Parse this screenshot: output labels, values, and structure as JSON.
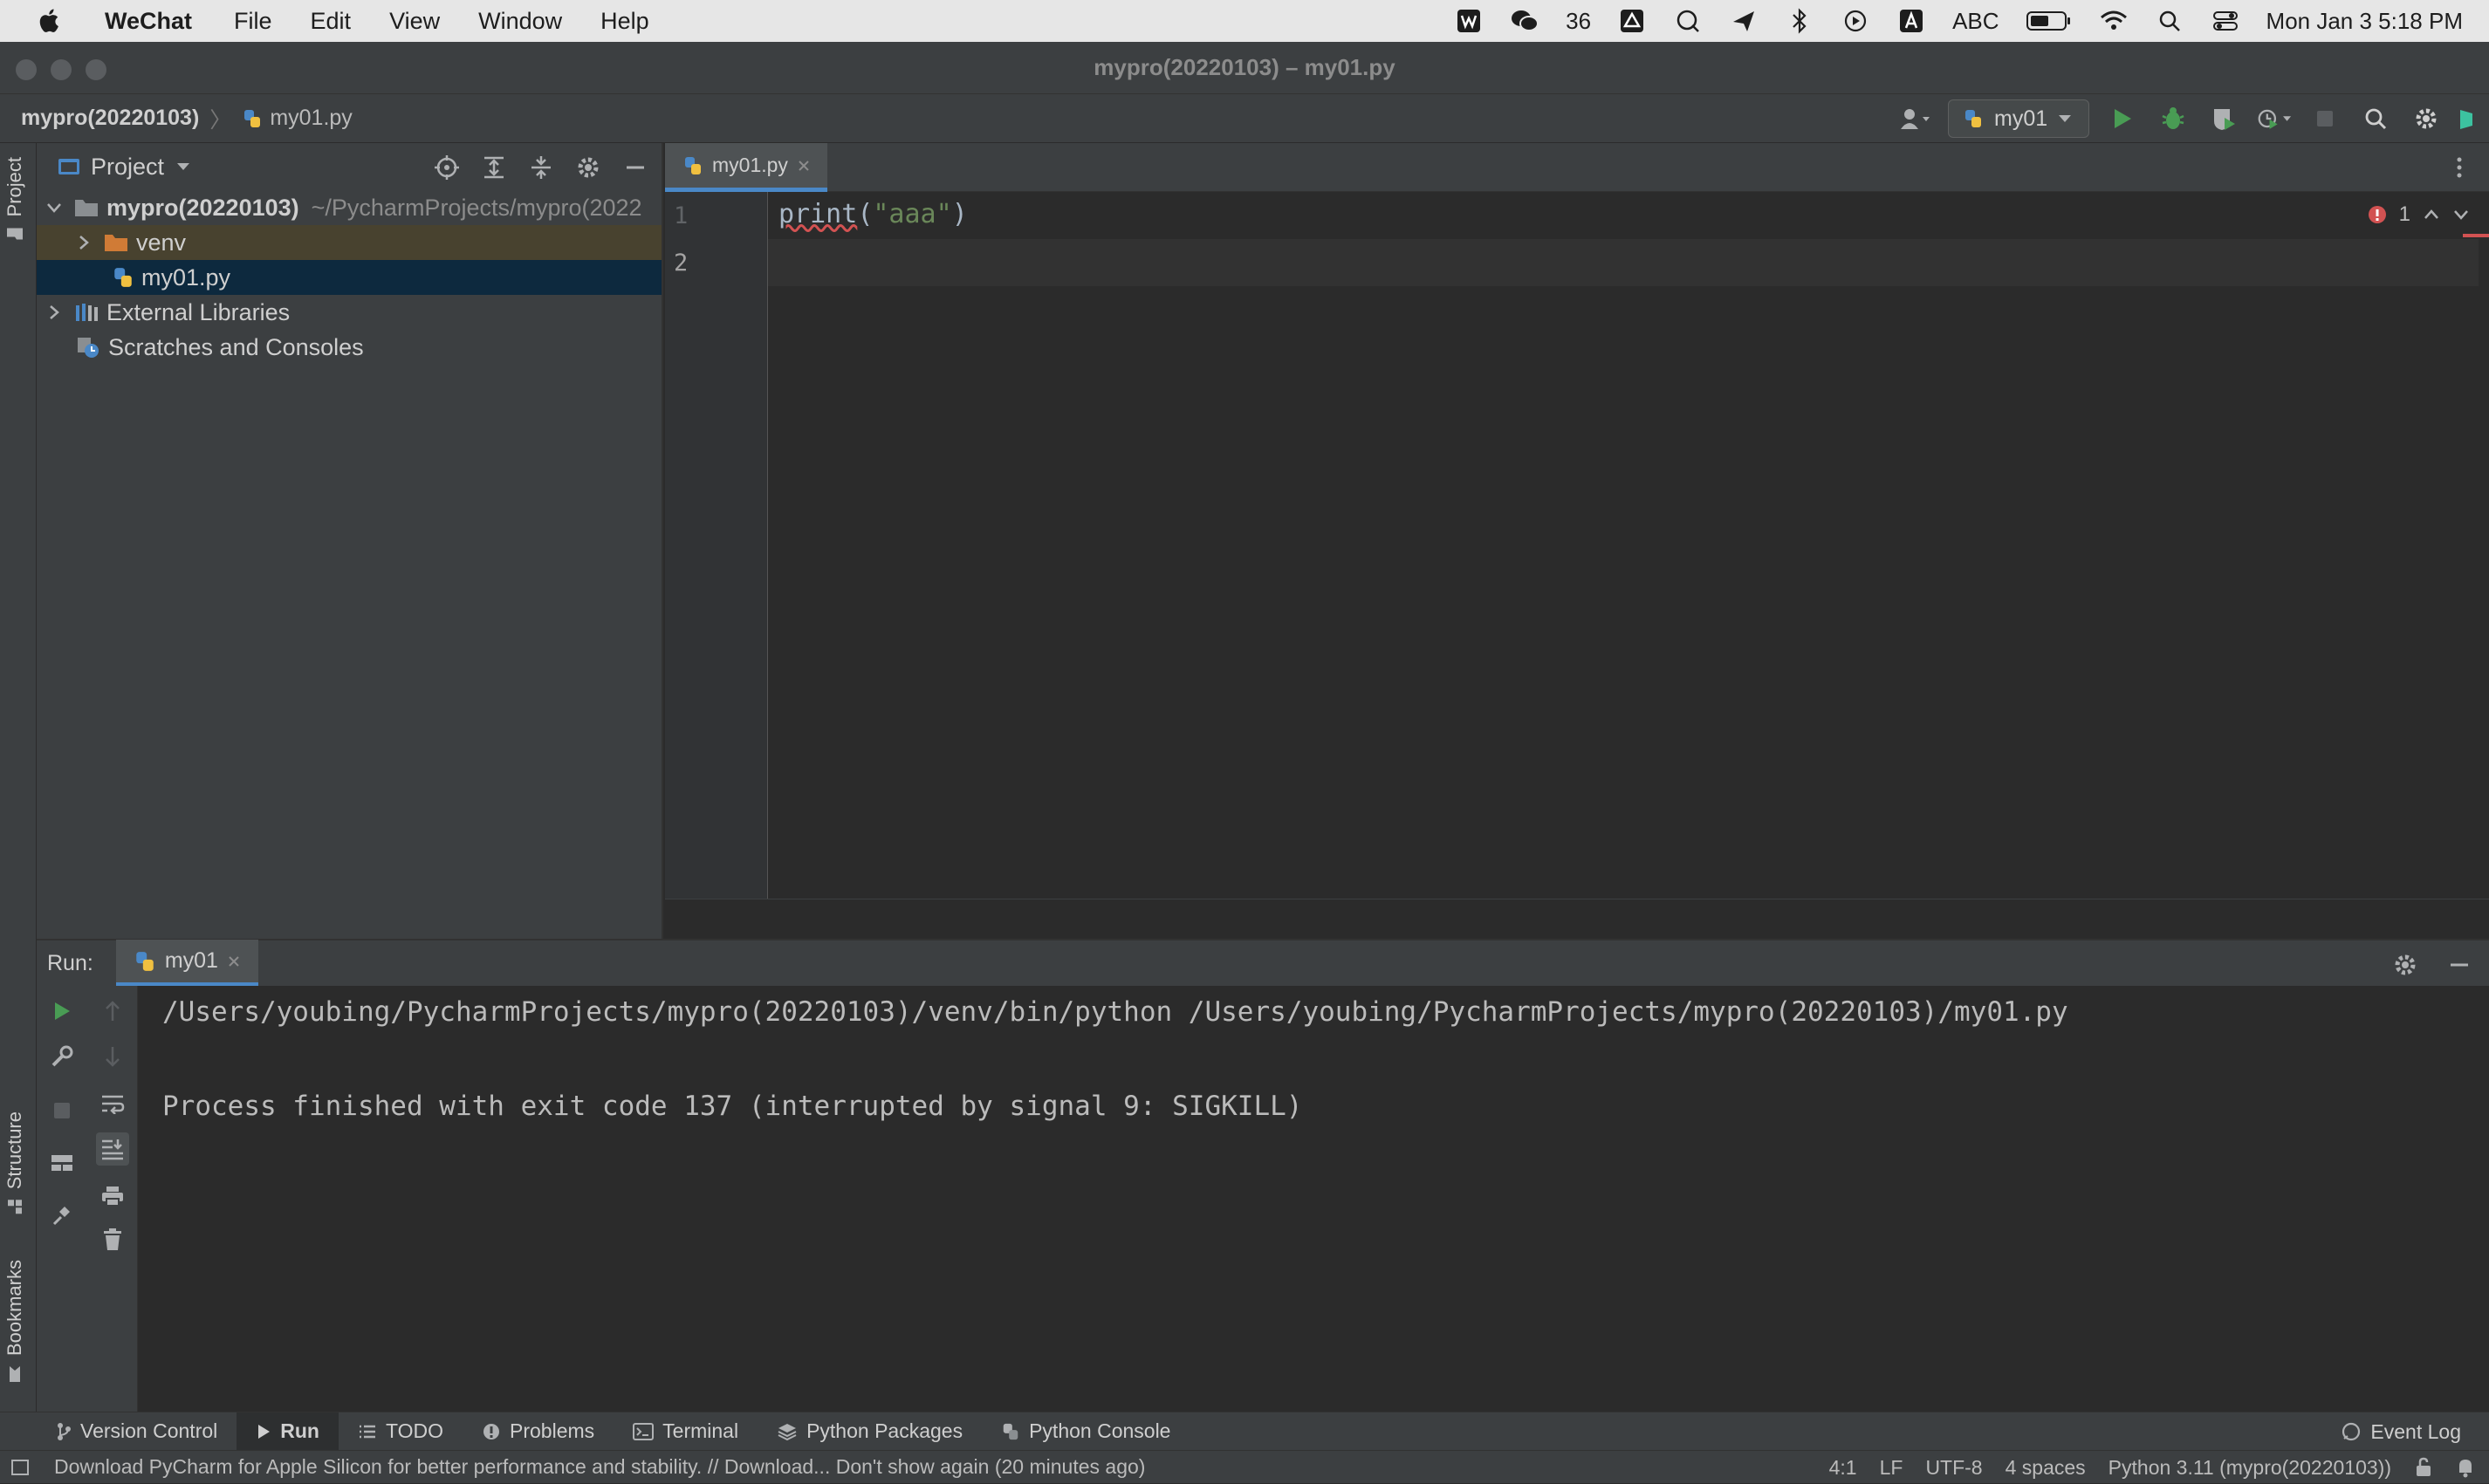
{
  "menubar": {
    "app_name": "WeChat",
    "items": [
      "File",
      "Edit",
      "View",
      "Window",
      "Help"
    ],
    "wechat_badge": "36",
    "input_source": "ABC",
    "clock": "Mon Jan 3  5:18 PM"
  },
  "window": {
    "title": "mypro(20220103) – my01.py"
  },
  "navbar": {
    "project": "mypro(20220103)",
    "file": "my01.py",
    "run_config": "my01"
  },
  "project_panel": {
    "title": "Project",
    "tree": {
      "root_name": "mypro(20220103)",
      "root_path": "~/PycharmProjects/mypro(2022",
      "venv": "venv",
      "file": "my01.py",
      "external": "External Libraries",
      "scratches": "Scratches and Consoles"
    }
  },
  "editor": {
    "tab_label": "my01.py",
    "line_numbers": [
      "1",
      "2"
    ],
    "code": {
      "fn": "print",
      "open": "(",
      "string": "\"aaa\"",
      "close": ")"
    },
    "problem_count": "1"
  },
  "run_panel": {
    "label": "Run:",
    "tab": "my01",
    "output": [
      "/Users/youbing/PycharmProjects/mypro(20220103)/venv/bin/python /Users/youbing/PycharmProjects/mypro(20220103)/my01.py",
      "Process finished with exit code 137 (interrupted by signal 9: SIGKILL)"
    ]
  },
  "side_tabs": {
    "project": "Project",
    "structure": "Structure",
    "bookmarks": "Bookmarks"
  },
  "bottom_tabs": {
    "version_control": "Version Control",
    "run": "Run",
    "todo": "TODO",
    "problems": "Problems",
    "terminal": "Terminal",
    "python_packages": "Python Packages",
    "python_console": "Python Console",
    "event_log": "Event Log"
  },
  "statusbar": {
    "message": "Download PyCharm for Apple Silicon for better performance and stability. // Download...   Don't show again (20 minutes ago)",
    "position": "4:1",
    "line_sep": "LF",
    "encoding": "UTF-8",
    "indent": "4 spaces",
    "interpreter": "Python 3.11 (mypro(20220103))"
  },
  "colors": {
    "accent": "#4a88c7",
    "run_green": "#499c54",
    "error_red": "#d25252"
  }
}
